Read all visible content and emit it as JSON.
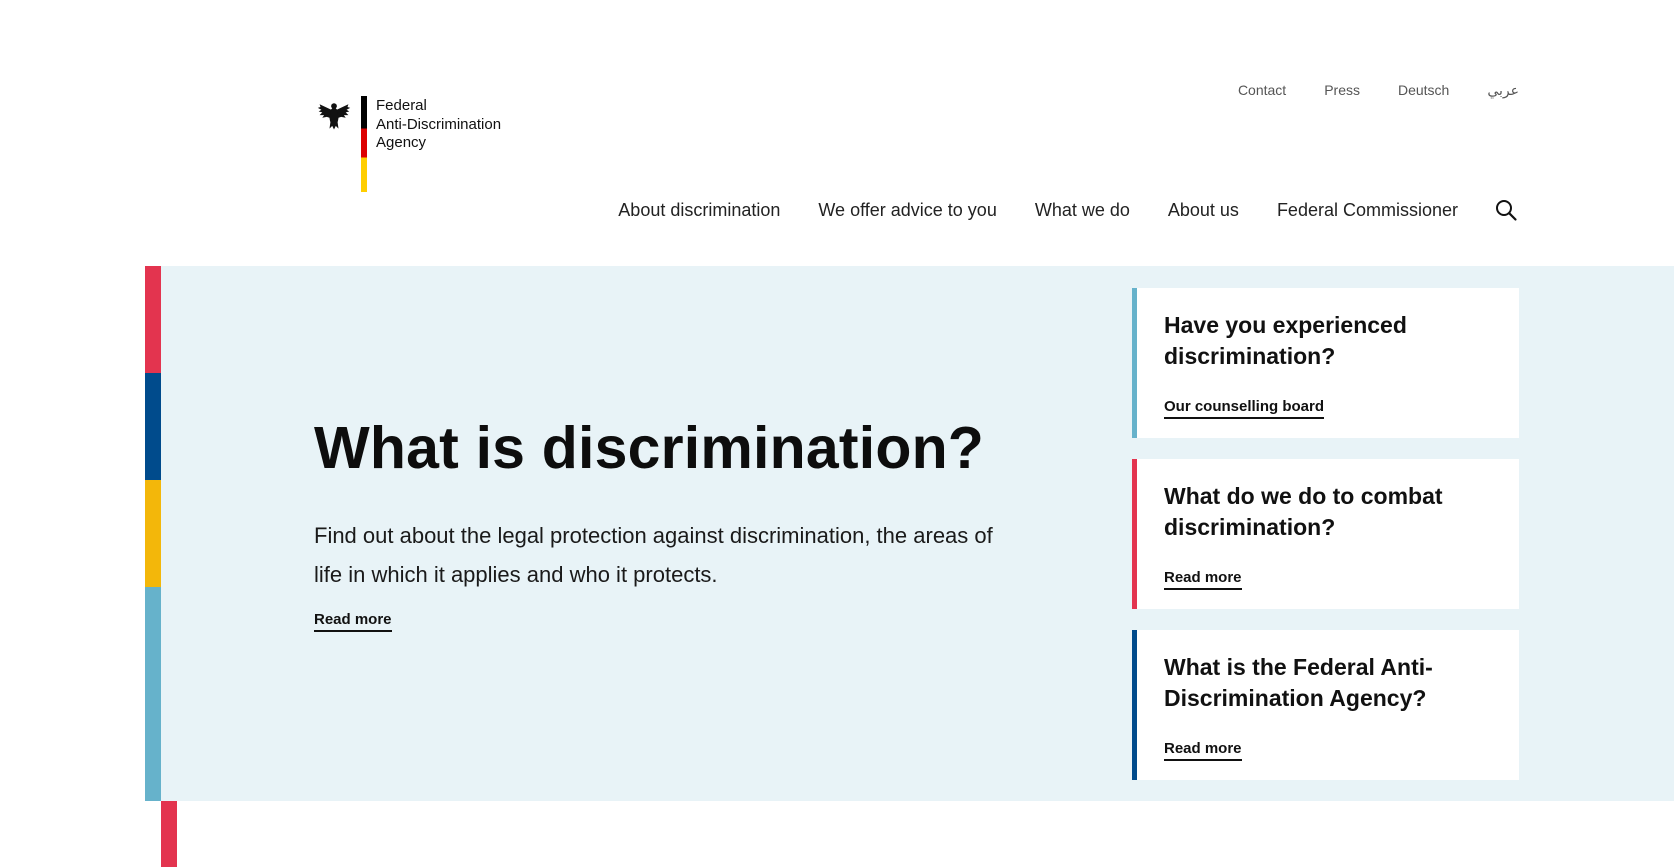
{
  "logo": {
    "line1": "Federal",
    "line2": "Anti-Discrimination",
    "line3": "Agency"
  },
  "meta_nav": {
    "contact": "Contact",
    "press": "Press",
    "deutsch": "Deutsch",
    "arabic": "عربي"
  },
  "main_nav": {
    "items": [
      {
        "label": "About discrimination"
      },
      {
        "label": "We offer advice to you"
      },
      {
        "label": "What we do"
      },
      {
        "label": "About us"
      },
      {
        "label": "Federal Commissioner"
      }
    ],
    "search_icon": "search-icon"
  },
  "hero": {
    "title": "What is discrimination?",
    "text": "Find out about the legal protection against discrimination, the areas of life in which it applies and who it protects.",
    "link": "Read more"
  },
  "cards": [
    {
      "title": "Have you experienced discrimination?",
      "link": "Our counselling board",
      "accent": "#66b2cb"
    },
    {
      "title": "What do we do to combat discrimination?",
      "link": "Read more",
      "accent": "#e3344f"
    },
    {
      "title": "What is the Federal Anti-Discrimination Agency?",
      "link": "Read more",
      "accent": "#004b8c"
    }
  ],
  "colors": {
    "hero_bg": "#e8f3f7",
    "stripe_red": "#e3344f",
    "stripe_blue": "#004b8c",
    "stripe_yellow": "#f3b70a",
    "stripe_teal": "#66b2cb"
  }
}
